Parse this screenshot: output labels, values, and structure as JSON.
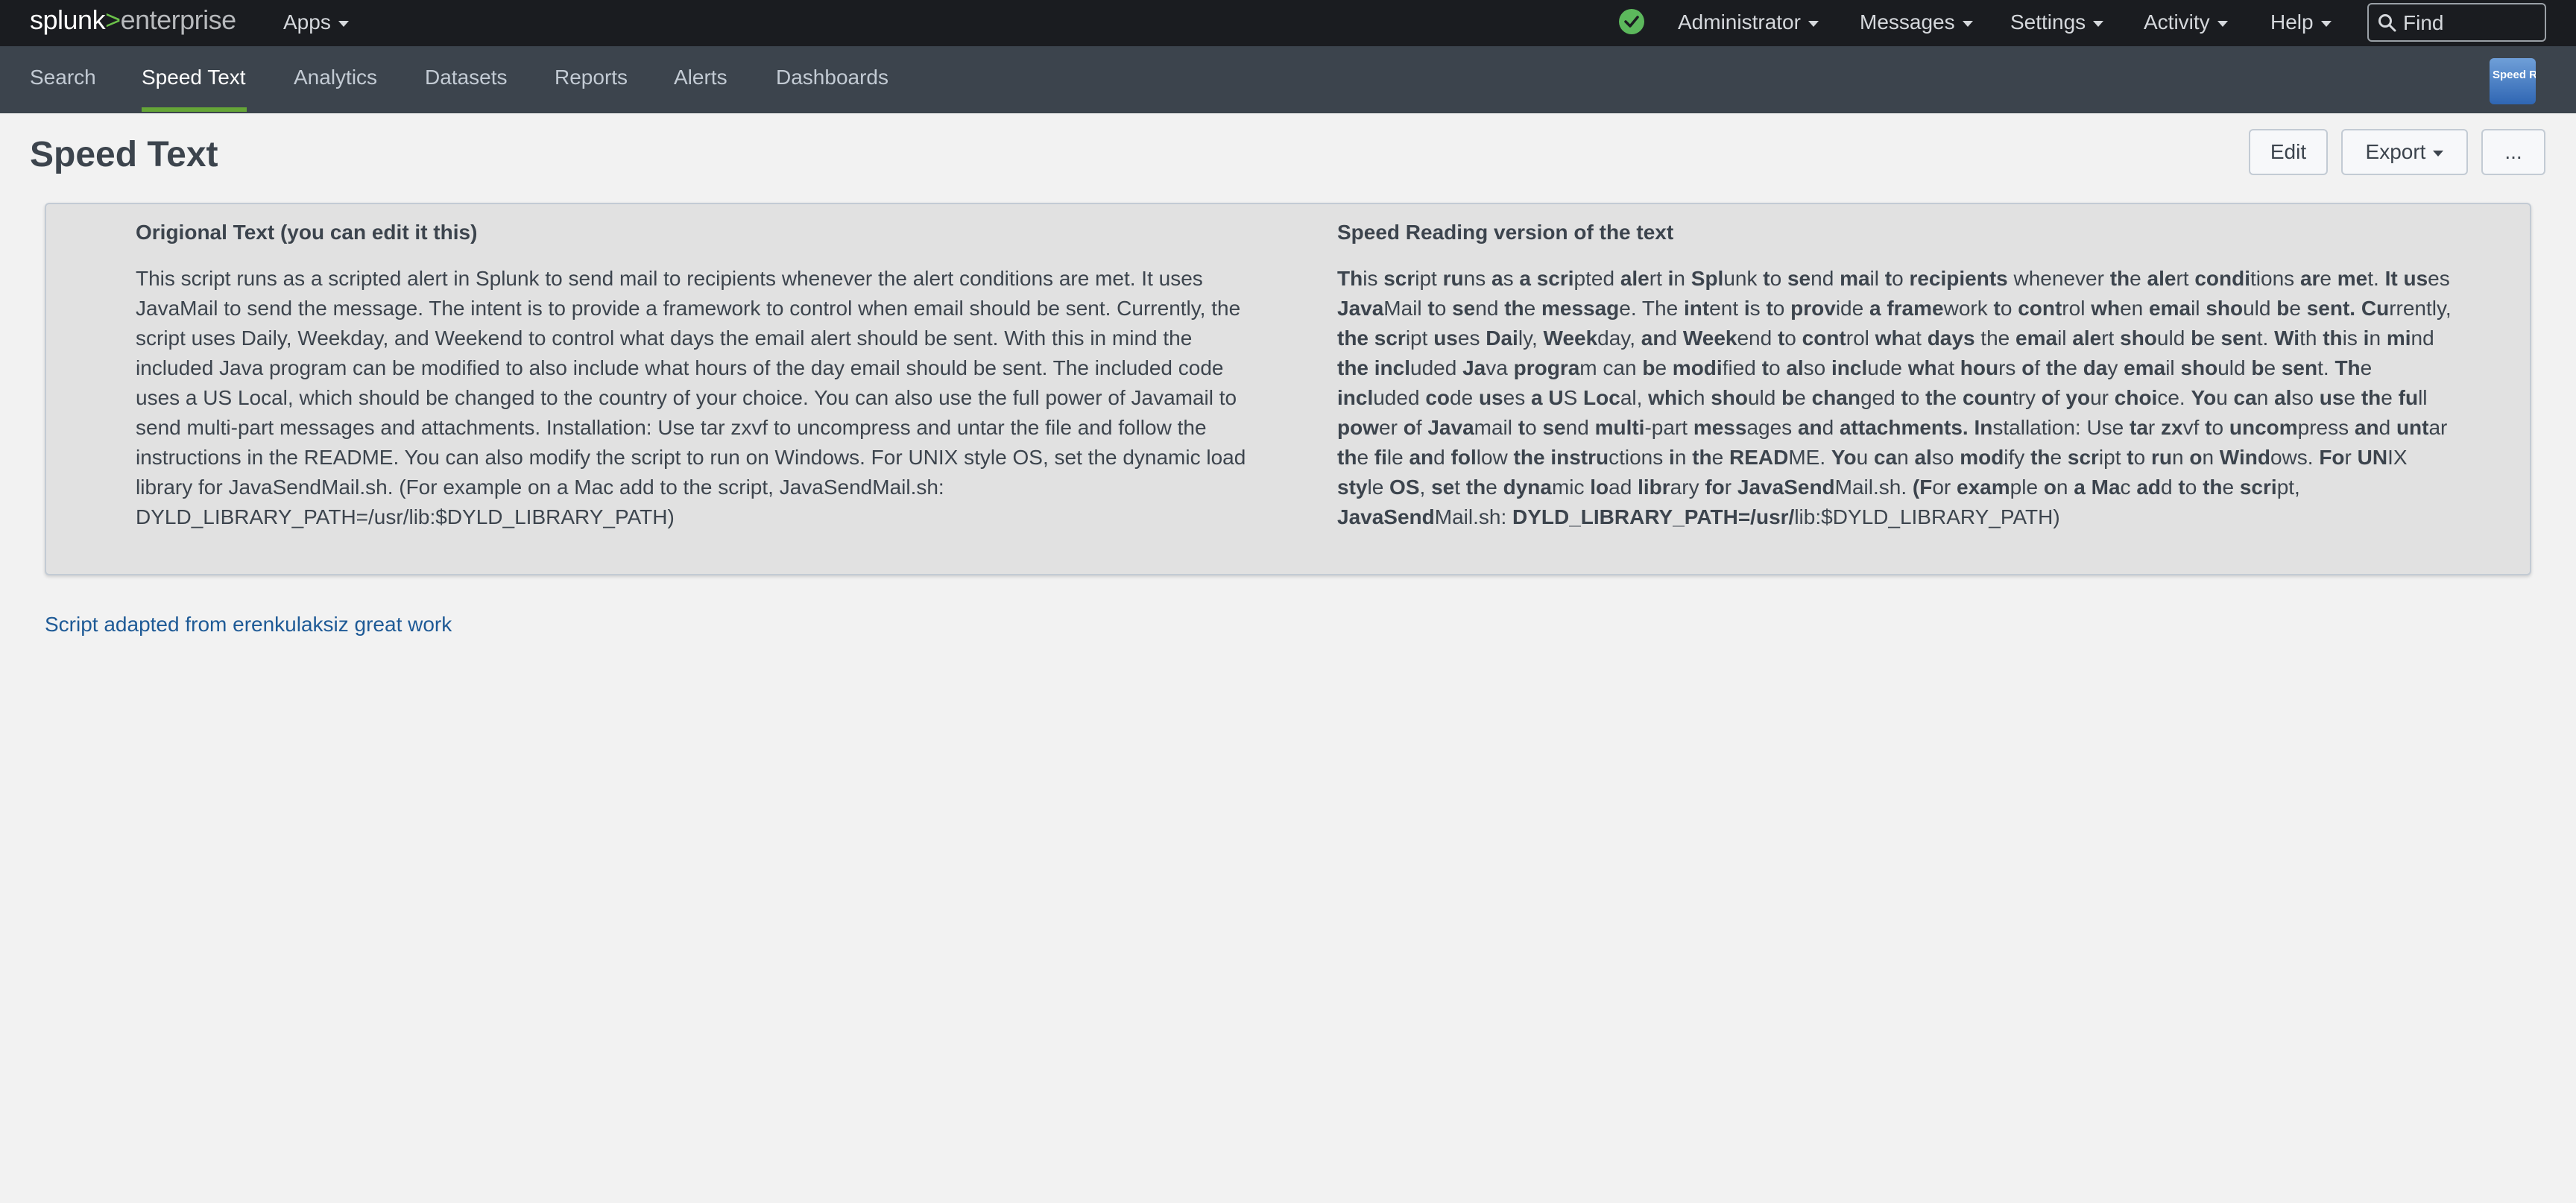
{
  "topbar": {
    "logo_prefix": "splunk",
    "logo_gt": ">",
    "logo_suffix": "enterprise",
    "apps_label": "Apps",
    "status_color": "#5cb85c",
    "menus": [
      "Administrator",
      "Messages",
      "Settings",
      "Activity",
      "Help"
    ],
    "find_placeholder": "Find"
  },
  "appnav": {
    "tabs": [
      "Search",
      "Speed Text",
      "Analytics",
      "Datasets",
      "Reports",
      "Alerts",
      "Dashboards"
    ],
    "active_tab": "Speed Text",
    "app_icon_label": "Speed Readin",
    "accent": "#65a637"
  },
  "page": {
    "title": "Speed Text",
    "edit_label": "Edit",
    "export_label": "Export",
    "more_label": "..."
  },
  "panel": {
    "left_title": "Origional Text (you can edit it this)",
    "left_text": "This script runs as a scripted alert in Splunk to send mail to recipients whenever the alert conditions are met. It uses JavaMail to send the message. The intent is to provide a framework to control when email should be sent. Currently, the script uses Daily, Weekday, and Weekend to control what days the email alert should be sent. With this in mind the included Java program can be modified to also include what hours of the day email should be sent. The included code uses a US Local, which should be changed to the country of your choice. You can also use the full power of Javamail to send multi-part messages and attachments. Installation: Use tar zxvf to uncompress and untar the file and follow the instructions in the README. You can also modify the script to run on Windows. For UNIX style OS, set the dynamic load library for JavaSendMail.sh. (For example on a Mac add to the script, JavaSendMail.sh: DYLD_LIBRARY_PATH=/usr/lib:$DYLD_LIBRARY_PATH)",
    "right_title": "Speed Reading version of the text",
    "right_segments": [
      [
        "Th",
        "is "
      ],
      [
        "scr",
        "ipt "
      ],
      [
        "ru",
        "ns "
      ],
      [
        "a",
        "s "
      ],
      [
        "a",
        ""
      ],
      [
        " scri",
        "pted "
      ],
      [
        "ale",
        "rt "
      ],
      [
        "i",
        "n "
      ],
      [
        "Spl",
        "unk "
      ],
      [
        "t",
        "o "
      ],
      [
        "se",
        "nd "
      ],
      [
        "ma",
        "il "
      ],
      [
        "t",
        "o "
      ],
      [
        "recipients",
        ""
      ],
      [
        "",
        " whenever "
      ],
      [
        "th",
        "e "
      ],
      [
        "ale",
        "rt "
      ],
      [
        "condi",
        "tions "
      ],
      [
        "ar",
        "e "
      ],
      [
        "me",
        "t. "
      ],
      [
        "It",
        ""
      ],
      [
        " us",
        "es "
      ],
      [
        "Java",
        "Mail "
      ],
      [
        "t",
        "o "
      ],
      [
        "se",
        "nd "
      ],
      [
        "th",
        "e "
      ],
      [
        "messag",
        "e. The "
      ],
      [
        "int",
        "ent "
      ],
      [
        "i",
        "s "
      ],
      [
        "t",
        "o "
      ],
      [
        "prov",
        "ide "
      ],
      [
        "a",
        ""
      ],
      [
        " frame",
        "work "
      ],
      [
        "t",
        "o "
      ],
      [
        "cont",
        "rol "
      ],
      [
        "wh",
        "en "
      ],
      [
        "ema",
        "il "
      ],
      [
        "sho",
        "uld "
      ],
      [
        "b",
        "e "
      ],
      [
        "sent.",
        ""
      ],
      [
        " Cu",
        "rrently, "
      ],
      [
        "the",
        ""
      ],
      [
        " scr",
        "ipt "
      ],
      [
        "us",
        "es "
      ],
      [
        "Dai",
        "ly, "
      ],
      [
        "Week",
        "day, "
      ],
      [
        "an",
        "d "
      ],
      [
        "Week",
        "end "
      ],
      [
        "t",
        "o "
      ],
      [
        "cont",
        "rol "
      ],
      [
        "wh",
        "at "
      ],
      [
        "days",
        ""
      ],
      [
        "",
        " the "
      ],
      [
        "ema",
        "il "
      ],
      [
        "ale",
        "rt "
      ],
      [
        "sho",
        "uld "
      ],
      [
        "b",
        "e "
      ],
      [
        "sen",
        "t. "
      ],
      [
        "Wi",
        "th "
      ],
      [
        "th",
        "is "
      ],
      [
        "i",
        "n "
      ],
      [
        "mi",
        "nd "
      ],
      [
        "the",
        ""
      ],
      [
        " incl",
        "uded "
      ],
      [
        "Ja",
        "va "
      ],
      [
        "progra",
        "m can "
      ],
      [
        "b",
        "e "
      ],
      [
        "modi",
        "fied "
      ],
      [
        "t",
        "o "
      ],
      [
        "al",
        "so "
      ],
      [
        "incl",
        "ude "
      ],
      [
        "wh",
        "at "
      ],
      [
        "hou",
        "rs "
      ],
      [
        "o",
        "f "
      ],
      [
        "th",
        "e "
      ],
      [
        "da",
        "y "
      ],
      [
        "ema",
        "il "
      ],
      [
        "sho",
        "uld "
      ],
      [
        "b",
        "e "
      ],
      [
        "sen",
        "t. "
      ],
      [
        "Th",
        "e "
      ],
      [
        "incl",
        "uded "
      ],
      [
        "co",
        "de "
      ],
      [
        "us",
        "es "
      ],
      [
        "a",
        ""
      ],
      [
        " U",
        "S "
      ],
      [
        "Loc",
        "al, "
      ],
      [
        "whi",
        "ch "
      ],
      [
        "sho",
        "uld "
      ],
      [
        "b",
        "e "
      ],
      [
        "chan",
        "ged "
      ],
      [
        "t",
        "o "
      ],
      [
        "th",
        "e "
      ],
      [
        "coun",
        "try "
      ],
      [
        "o",
        "f "
      ],
      [
        "yo",
        "ur "
      ],
      [
        "choi",
        "ce. "
      ],
      [
        "Yo",
        "u "
      ],
      [
        "ca",
        "n "
      ],
      [
        "al",
        "so "
      ],
      [
        "us",
        "e "
      ],
      [
        "th",
        "e "
      ],
      [
        "fu",
        "ll "
      ],
      [
        "pow",
        "er "
      ],
      [
        "o",
        "f "
      ],
      [
        "Java",
        "mail "
      ],
      [
        "t",
        "o "
      ],
      [
        "se",
        "nd "
      ],
      [
        "multi",
        "-part "
      ],
      [
        "mess",
        "ages "
      ],
      [
        "an",
        "d "
      ],
      [
        "attachments.",
        ""
      ],
      [
        " In",
        "stallation: Use "
      ],
      [
        "ta",
        "r "
      ],
      [
        "zx",
        "vf "
      ],
      [
        "t",
        "o "
      ],
      [
        "uncom",
        "press "
      ],
      [
        "an",
        "d "
      ],
      [
        "unt",
        "ar "
      ],
      [
        "th",
        "e "
      ],
      [
        "fi",
        "le "
      ],
      [
        "an",
        "d "
      ],
      [
        "fol",
        "low "
      ],
      [
        "the",
        ""
      ],
      [
        " instru",
        "ctions "
      ],
      [
        "i",
        "n "
      ],
      [
        "th",
        "e "
      ],
      [
        "READ",
        "ME. "
      ],
      [
        "Yo",
        "u "
      ],
      [
        "ca",
        "n "
      ],
      [
        "al",
        "so "
      ],
      [
        "mod",
        "ify "
      ],
      [
        "th",
        "e "
      ],
      [
        "scr",
        "ipt "
      ],
      [
        "t",
        "o "
      ],
      [
        "ru",
        "n "
      ],
      [
        "o",
        "n "
      ],
      [
        "Wind",
        "ows. "
      ],
      [
        "Fo",
        "r "
      ],
      [
        "UN",
        "IX "
      ],
      [
        "sty",
        "le "
      ],
      [
        "OS",
        ", "
      ],
      [
        "se",
        "t "
      ],
      [
        "th",
        "e "
      ],
      [
        "dyna",
        "mic "
      ],
      [
        "lo",
        "ad "
      ],
      [
        "libr",
        "ary "
      ],
      [
        "fo",
        "r "
      ],
      [
        "JavaSend",
        "Mail.sh. "
      ],
      [
        "(F",
        "or "
      ],
      [
        "exam",
        "ple "
      ],
      [
        "o",
        "n "
      ],
      [
        "a",
        ""
      ],
      [
        " Ma",
        "c "
      ],
      [
        "ad",
        "d "
      ],
      [
        "t",
        "o "
      ],
      [
        "th",
        "e "
      ],
      [
        "scri",
        "pt, "
      ],
      [
        "JavaSend",
        "Mail.sh: "
      ],
      [
        "DYLD_LIBRARY_PATH=/usr/",
        "lib:$DYLD_LIBRARY_PATH)"
      ]
    ]
  },
  "footer": {
    "link_text": "Script adapted from erenkulaksiz great work"
  }
}
